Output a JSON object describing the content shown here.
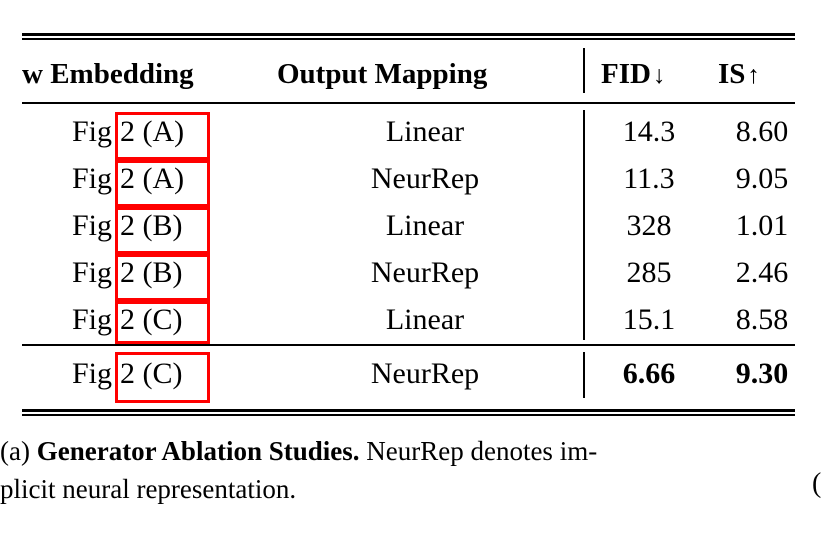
{
  "table": {
    "headers": {
      "col1": "w Embedding",
      "col2": "Output Mapping",
      "col3": "FID",
      "col3_arrow": "↓",
      "col4": "IS",
      "col4_arrow": "↑"
    },
    "rows": [
      {
        "fig_prefix": "Fig",
        "fig_ref": "2 (A)",
        "mapping": "Linear",
        "fid": "14.3",
        "is": "8.60",
        "bold": false,
        "highlighted": true
      },
      {
        "fig_prefix": "Fig",
        "fig_ref": "2 (A)",
        "mapping": "NeurRep",
        "fid": "11.3",
        "is": "9.05",
        "bold": false,
        "highlighted": true
      },
      {
        "fig_prefix": "Fig",
        "fig_ref": "2 (B)",
        "mapping": "Linear",
        "fid": "328",
        "is": "1.01",
        "bold": false,
        "highlighted": true
      },
      {
        "fig_prefix": "Fig",
        "fig_ref": "2 (B)",
        "mapping": "NeurRep",
        "fid": "285",
        "is": "2.46",
        "bold": false,
        "highlighted": true
      },
      {
        "fig_prefix": "Fig",
        "fig_ref": "2 (C)",
        "mapping": "Linear",
        "fid": "15.1",
        "is": "8.58",
        "bold": false,
        "highlighted": true
      }
    ],
    "final_row": {
      "fig_prefix": "Fig",
      "fig_ref": "2 (C)",
      "mapping": "NeurRep",
      "fid": "6.66",
      "is": "9.30",
      "bold": true,
      "highlighted": true
    }
  },
  "caption": {
    "label": "(a)",
    "title": "Generator Ablation Studies.",
    "line1_rest": "NeurRep denotes im-",
    "line2": "plicit neural representation."
  },
  "annotation": {
    "highlight_color": "#ff0000"
  },
  "neighbor_fragment": "("
}
